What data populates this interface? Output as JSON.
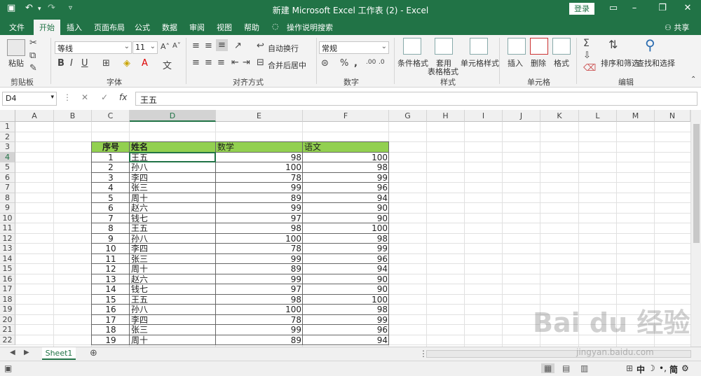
{
  "window": {
    "title": "新建 Microsoft Excel 工作表 (2)  -  Excel",
    "login_label": "登录",
    "share_label": "共享"
  },
  "tabs": [
    "文件",
    "开始",
    "插入",
    "页面布局",
    "公式",
    "数据",
    "审阅",
    "视图",
    "帮助",
    "操作说明搜索"
  ],
  "ribbon": {
    "clipboard": {
      "paste": "粘贴",
      "label": "剪贴板"
    },
    "font": {
      "name": "等线",
      "size": "11",
      "label": "字体",
      "bold": "B",
      "italic": "I",
      "underline": "U"
    },
    "alignment": {
      "wrap": "自动换行",
      "merge": "合并后居中",
      "label": "对齐方式"
    },
    "number": {
      "format": "常规",
      "label": "数字"
    },
    "styles": {
      "conditional": "条件格式",
      "table": "套用",
      "table2": "表格格式",
      "cell_styles": "单元格样式",
      "label": "样式"
    },
    "cells": {
      "insert": "插入",
      "delete": "删除",
      "format": "格式",
      "label": "单元格"
    },
    "editing": {
      "sort": "排序和筛选",
      "find": "查找和选择",
      "label": "编辑"
    }
  },
  "formula_bar": {
    "name_box": "D4",
    "fx": "fx",
    "content": "王五"
  },
  "columns": [
    "A",
    "B",
    "C",
    "D",
    "E",
    "F",
    "G",
    "H",
    "I",
    "J",
    "K",
    "L",
    "M",
    "N"
  ],
  "rows": [
    "1",
    "2",
    "3",
    "4",
    "5",
    "6",
    "7",
    "8",
    "9",
    "10",
    "11",
    "12",
    "13",
    "14",
    "15",
    "16",
    "17",
    "18",
    "19",
    "20",
    "21",
    "22"
  ],
  "table": {
    "headers": [
      "序号",
      "姓名",
      "数学",
      "语文"
    ],
    "rows": [
      [
        "1",
        "王五",
        "98",
        "100"
      ],
      [
        "2",
        "孙八",
        "100",
        "98"
      ],
      [
        "3",
        "李四",
        "78",
        "99"
      ],
      [
        "4",
        "张三",
        "99",
        "96"
      ],
      [
        "5",
        "周十",
        "89",
        "94"
      ],
      [
        "6",
        "赵六",
        "99",
        "90"
      ],
      [
        "7",
        "钱七",
        "97",
        "90"
      ],
      [
        "8",
        "王五",
        "98",
        "100"
      ],
      [
        "9",
        "孙八",
        "100",
        "98"
      ],
      [
        "10",
        "李四",
        "78",
        "99"
      ],
      [
        "11",
        "张三",
        "99",
        "96"
      ],
      [
        "12",
        "周十",
        "89",
        "94"
      ],
      [
        "13",
        "赵六",
        "99",
        "90"
      ],
      [
        "14",
        "钱七",
        "97",
        "90"
      ],
      [
        "15",
        "王五",
        "98",
        "100"
      ],
      [
        "16",
        "孙八",
        "100",
        "98"
      ],
      [
        "17",
        "李四",
        "78",
        "99"
      ],
      [
        "18",
        "张三",
        "99",
        "96"
      ],
      [
        "19",
        "周十",
        "89",
        "94"
      ]
    ],
    "header_color": "#92d050"
  },
  "sheet": {
    "tab": "Sheet1"
  },
  "status": {
    "ime": "中",
    "ime2": "简"
  },
  "watermark": {
    "text": "Bai du 经验",
    "sub": "jingyan.baidu.com"
  },
  "colors": {
    "accent": "#217346"
  }
}
